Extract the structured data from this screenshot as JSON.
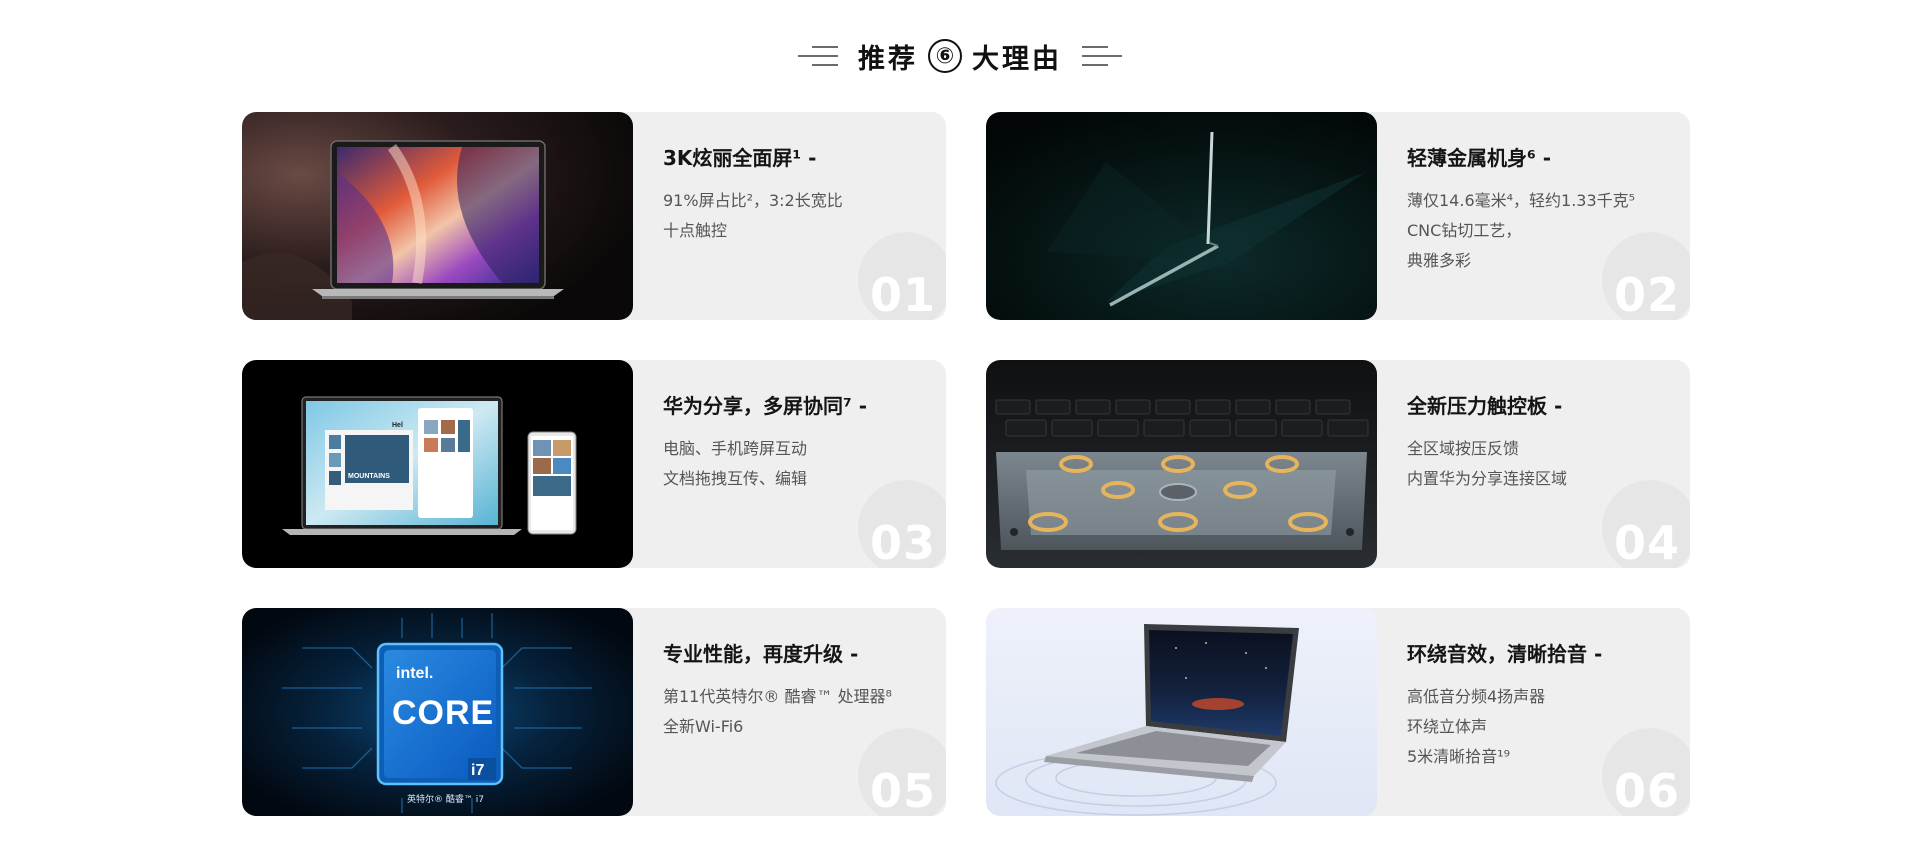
{
  "header": {
    "title_pre": "推荐",
    "title_num": "⑥",
    "title_post": "大理由"
  },
  "cards": [
    {
      "title": "3K炫丽全面屏¹ -",
      "desc": "91%屏占比²，3:2长宽比\n十点触控",
      "index": "01",
      "image": "laptop-canyon-wallpaper"
    },
    {
      "title": "轻薄金属机身⁶ -",
      "desc": "薄仅14.6毫米⁴，轻约1.33千克⁵\nCNC钻切工艺，\n典雅多彩",
      "index": "02",
      "image": "laptop-side-profile"
    },
    {
      "title": "华为分享，多屏协同⁷ -",
      "desc": "电脑、手机跨屏互动\n文档拖拽互传、编辑",
      "index": "03",
      "image": "laptop-and-phone"
    },
    {
      "title": "全新压力触控板 -",
      "desc": "全区域按压反馈\n内置华为分享连接区域",
      "index": "04",
      "image": "touchpad-internals"
    },
    {
      "title": "专业性能，再度升级 -",
      "desc": "第11代英特尔® 酷睿™ 处理器⁸\n全新Wi-Fi6",
      "index": "05",
      "image": "intel-core-i7-chip"
    },
    {
      "title": "环绕音效，清晰拾音 -",
      "desc": "高低音分频4扬声器\n环绕立体声\n5米清晰拾音¹⁹",
      "index": "06",
      "image": "laptop-sound-waves"
    }
  ],
  "chip": {
    "brand": "intel.",
    "name": "CORE",
    "tier": "i7",
    "caption": "英特尔® 酷睿™ i7"
  },
  "phone_text": {
    "mountains": "MOUNTAINS",
    "hello": "Hel"
  },
  "colors": {
    "card_bg": "#efefef",
    "index_circle": "#e6e6e6",
    "title": "#151515",
    "desc": "#555555"
  }
}
